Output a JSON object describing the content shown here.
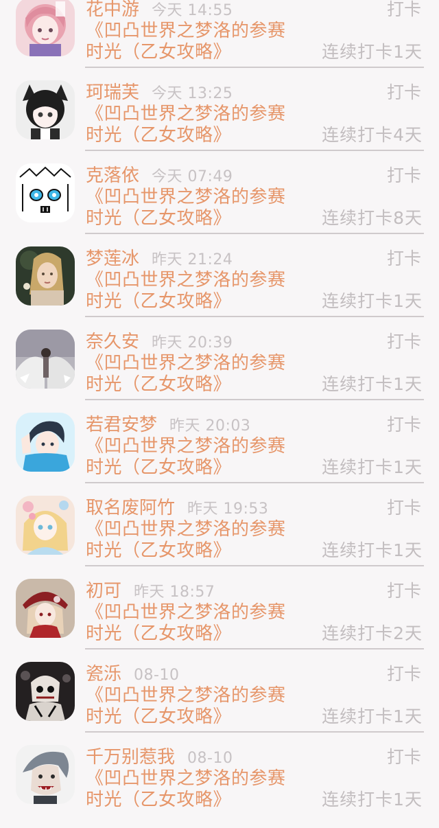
{
  "feed": {
    "entries": [
      {
        "name": "花中游",
        "time": "今天 14:55",
        "action": "打卡",
        "topic": "《凹凸世界之梦洛的参赛时光（乙女攻略》",
        "streak": "连续打卡1天",
        "avatar_icon": "avatar-pink-hair-girl"
      },
      {
        "name": "珂瑞芙",
        "time": "今天 13:25",
        "action": "打卡",
        "topic": "《凹凸世界之梦洛的参赛时光（乙女攻略》",
        "streak": "连续打卡4天",
        "avatar_icon": "avatar-maid-girl"
      },
      {
        "name": "克落依",
        "time": "今天 07:49",
        "action": "打卡",
        "topic": "《凹凸世界之梦洛的参赛时光（乙女攻略》",
        "streak": "连续打卡8天",
        "avatar_icon": "avatar-sketch-face"
      },
      {
        "name": "梦莲冰",
        "time": "昨天 21:24",
        "action": "打卡",
        "topic": "《凹凸世界之梦洛的参赛时光（乙女攻略》",
        "streak": "连续打卡1天",
        "avatar_icon": "avatar-elf-woman"
      },
      {
        "name": "奈久安",
        "time": "昨天 20:39",
        "action": "打卡",
        "topic": "《凹凸世界之梦洛的参赛时光（乙女攻略》",
        "streak": "连续打卡1天",
        "avatar_icon": "avatar-angel-wings"
      },
      {
        "name": "若君安梦",
        "time": "昨天 20:03",
        "action": "打卡",
        "topic": "《凹凸世界之梦洛的参赛时光（乙女攻略》",
        "streak": "连续打卡1天",
        "avatar_icon": "avatar-blue-boy"
      },
      {
        "name": "取名废阿竹",
        "time": "昨天 19:53",
        "action": "打卡",
        "topic": "《凹凸世界之梦洛的参赛时光（乙女攻略》",
        "streak": "连续打卡1天",
        "avatar_icon": "avatar-lolita-girl"
      },
      {
        "name": "初可",
        "time": "昨天 18:57",
        "action": "打卡",
        "topic": "《凹凸世界之梦洛的参赛时光（乙女攻略》",
        "streak": "连续打卡2天",
        "avatar_icon": "avatar-red-hat-girl"
      },
      {
        "name": "瓷泺",
        "time": "08-10",
        "action": "打卡",
        "topic": "《凹凸世界之梦洛的参赛时光（乙女攻略》",
        "streak": "连续打卡1天",
        "avatar_icon": "avatar-dark-creature"
      },
      {
        "name": "千万别惹我",
        "time": "08-10",
        "action": "打卡",
        "topic": "《凹凸世界之梦洛的参赛时光（乙女攻略》",
        "streak": "连续打卡1天",
        "avatar_icon": "avatar-gray-hair-man"
      }
    ]
  },
  "colors": {
    "accent": "#e6966a",
    "muted": "#c2bdbf",
    "background": "#f8f6f7"
  }
}
